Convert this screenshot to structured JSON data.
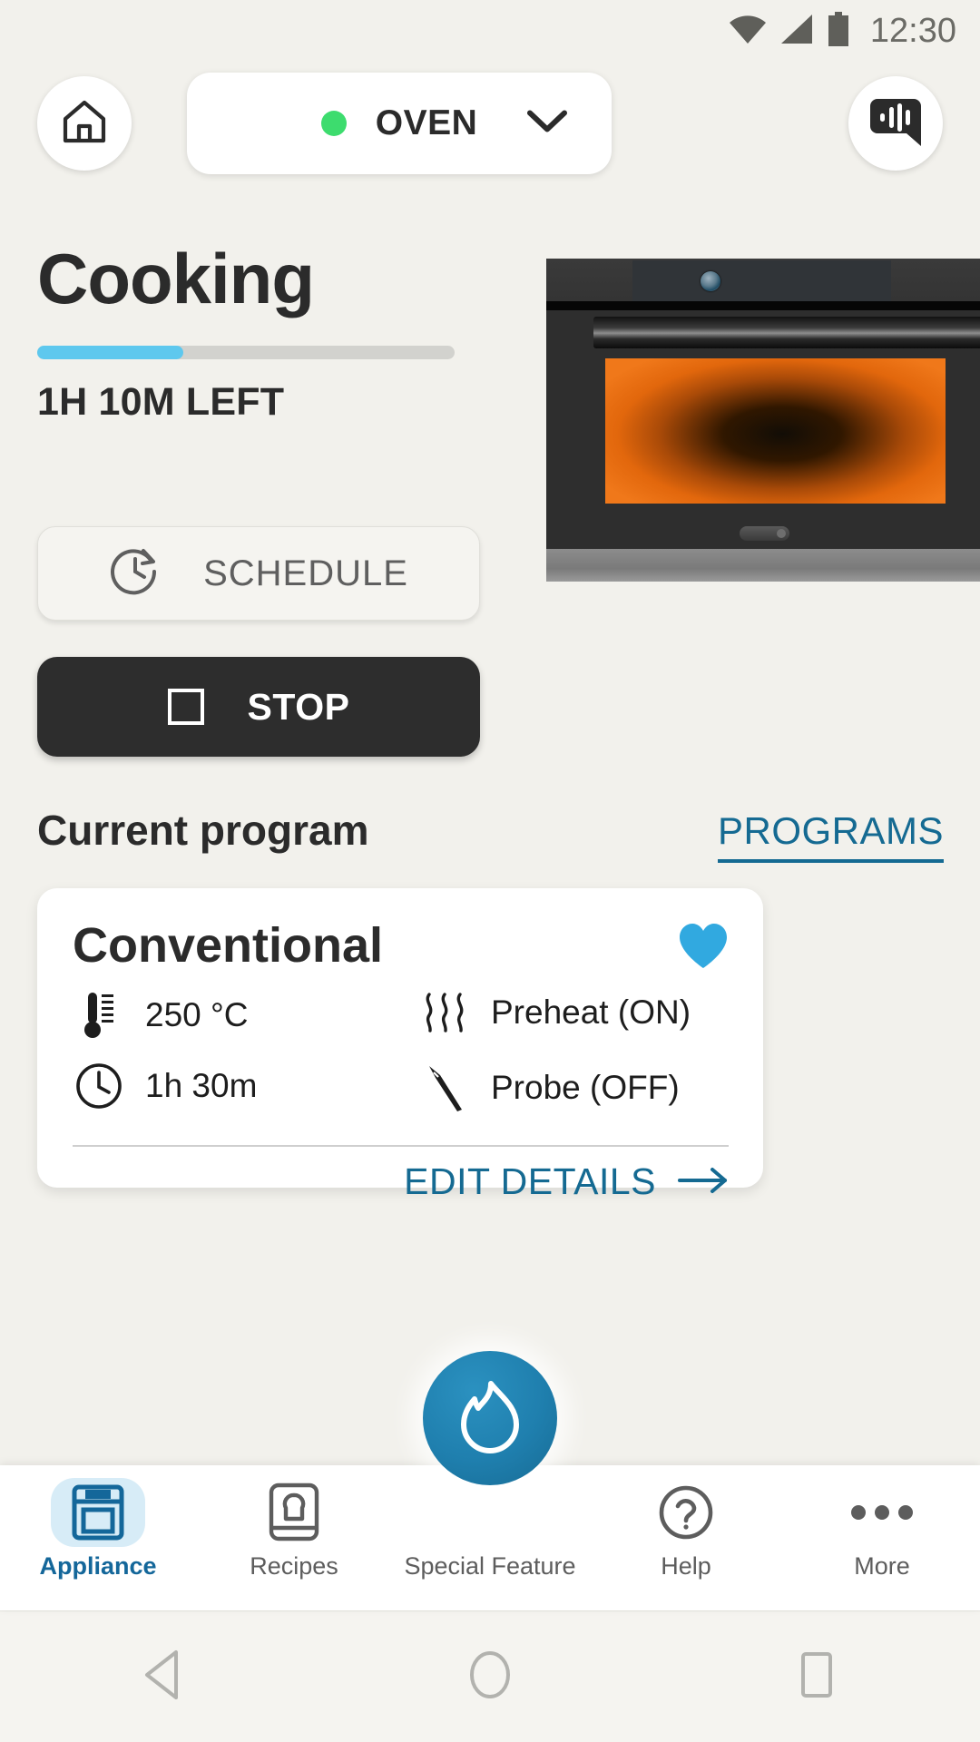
{
  "status_bar": {
    "time": "12:30",
    "icons": [
      "wifi-icon",
      "cellular-signal-icon",
      "battery-icon"
    ]
  },
  "header": {
    "home_button": "home-icon",
    "device_name": "OVEN",
    "device_status_color": "#3ddc6e",
    "dropdown_icon": "chevron-down-icon",
    "voice_button": "voice-assistant-icon"
  },
  "hero": {
    "title": "Cooking",
    "progress_percent": 35,
    "progress_color": "#5ec8ee",
    "time_left": "1H 10M LEFT",
    "appliance_image": "built-in-oven-photo"
  },
  "actions": {
    "schedule_label": "SCHEDULE",
    "schedule_icon": "clock-refresh-icon",
    "stop_label": "STOP",
    "stop_icon": "stop-square-icon"
  },
  "current_program_section": {
    "heading": "Current program",
    "programs_link": "PROGRAMS",
    "link_color": "#156a92"
  },
  "program_card": {
    "name": "Conventional",
    "favorite_icon": "heart-icon",
    "favorite_color": "#31a9e0",
    "specs": [
      {
        "icon": "thermometer-icon",
        "value": "250 °C"
      },
      {
        "icon": "preheat-steam-icon",
        "value": "Preheat (ON)"
      },
      {
        "icon": "clock-icon",
        "value": "1h 30m"
      },
      {
        "icon": "meat-probe-icon",
        "value": "Probe (OFF)"
      }
    ],
    "edit_label": "EDIT DETAILS",
    "edit_icon": "arrow-right-icon"
  },
  "bottom_nav": {
    "items": [
      {
        "label": "Appliance",
        "icon": "oven-icon",
        "active": true
      },
      {
        "label": "Recipes",
        "icon": "cookbook-icon",
        "active": false
      },
      {
        "label": "Special Feature",
        "icon": "flame-icon",
        "active": false
      },
      {
        "label": "Help",
        "icon": "question-circle-icon",
        "active": false
      },
      {
        "label": "More",
        "icon": "ellipsis-icon",
        "active": false
      }
    ],
    "fab_icon": "flame-icon",
    "fab_color": "#1f7fae",
    "active_color": "#14679a"
  },
  "android_nav": {
    "back": "back-triangle-icon",
    "home": "home-circle-icon",
    "recents": "recents-square-icon"
  }
}
